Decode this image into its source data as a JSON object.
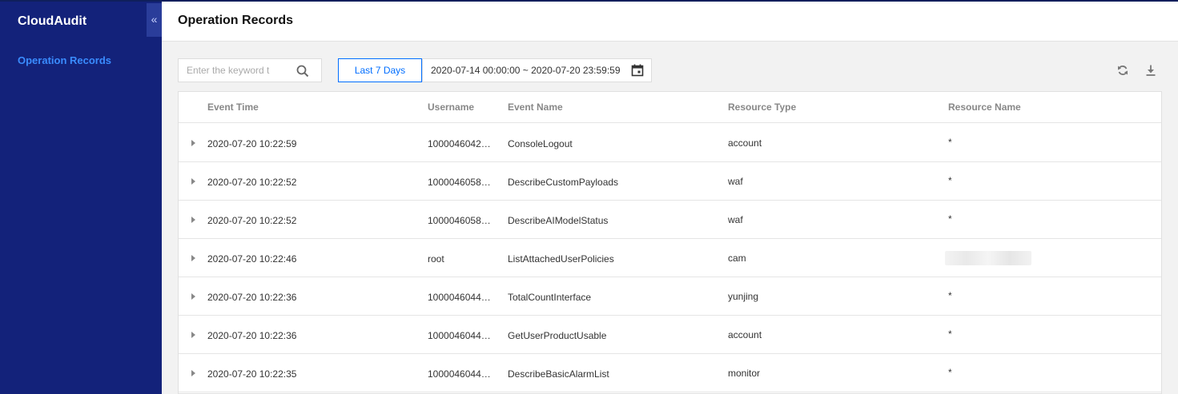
{
  "app": {
    "brand": "CloudAudit",
    "collapse_glyph": "«"
  },
  "sidebar": {
    "items": [
      {
        "label": "Operation Records"
      }
    ]
  },
  "header": {
    "title": "Operation Records"
  },
  "toolbar": {
    "search_placeholder": "Enter the keyword t",
    "search_icon": "search-icon",
    "period_button": "Last 7 Days",
    "date_range": "2020-07-14 00:00:00 ~ 2020-07-20 23:59:59",
    "calendar_icon": "calendar-icon",
    "refresh_icon": "refresh-icon",
    "download_icon": "download-icon"
  },
  "table": {
    "columns": [
      "Event Time",
      "Username",
      "Event Name",
      "Resource Type",
      "Resource Name"
    ],
    "rows": [
      {
        "time": "2020-07-20 10:22:59",
        "username": "1000046042…",
        "event": "ConsoleLogout",
        "type": "account",
        "resource": "*"
      },
      {
        "time": "2020-07-20 10:22:52",
        "username": "1000046058…",
        "event": "DescribeCustomPayloads",
        "type": "waf",
        "resource": "*"
      },
      {
        "time": "2020-07-20 10:22:52",
        "username": "1000046058…",
        "event": "DescribeAIModelStatus",
        "type": "waf",
        "resource": "*"
      },
      {
        "time": "2020-07-20 10:22:46",
        "username": "root",
        "event": "ListAttachedUserPolicies",
        "type": "cam",
        "resource": ""
      },
      {
        "time": "2020-07-20 10:22:36",
        "username": "1000046044…",
        "event": "TotalCountInterface",
        "type": "yunjing",
        "resource": "*"
      },
      {
        "time": "2020-07-20 10:22:36",
        "username": "1000046044…",
        "event": "GetUserProductUsable",
        "type": "account",
        "resource": "*"
      },
      {
        "time": "2020-07-20 10:22:35",
        "username": "1000046044…",
        "event": "DescribeBasicAlarmList",
        "type": "monitor",
        "resource": "*"
      }
    ]
  },
  "colors": {
    "sidebar": "#13227a",
    "accent": "#006eff",
    "nav_active": "#3a8cff"
  }
}
